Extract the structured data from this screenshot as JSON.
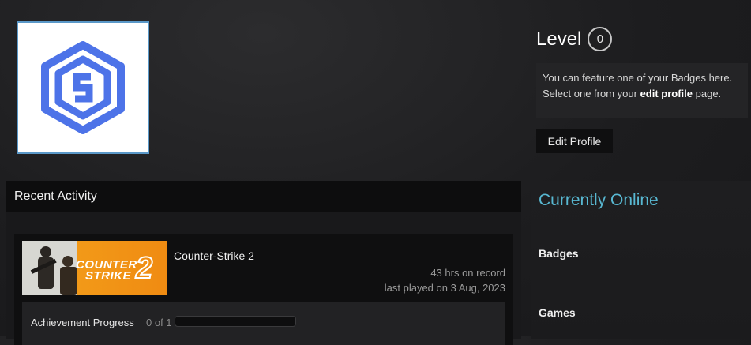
{
  "profile": {
    "avatar_icon": "cs-logo-icon",
    "avatar_color": "#4d73e8",
    "level_label": "Level",
    "level_value": "0",
    "badge_text_1": "You can feature one of your Badges here.",
    "badge_text_2": "Select one from your ",
    "badge_link": "edit profile",
    "badge_text_3": " page.",
    "edit_button": "Edit Profile"
  },
  "activity": {
    "header": "Recent Activity",
    "games": [
      {
        "title": "Counter-Strike 2",
        "thumb_text_1": "COUNTER",
        "thumb_text_2": "STRIKE",
        "thumb_text_3": "2",
        "hours": "43 hrs on record",
        "last_played": "last played on 3 Aug, 2023",
        "achievement_label": "Achievement Progress",
        "achievement_count": "0 of 1",
        "achievement_fraction": 0
      }
    ]
  },
  "sidebar": {
    "status": "Currently Online",
    "items": [
      "Badges",
      "Games"
    ]
  },
  "colors": {
    "accent": "#58b8d2",
    "background": "#1d1d1f"
  }
}
